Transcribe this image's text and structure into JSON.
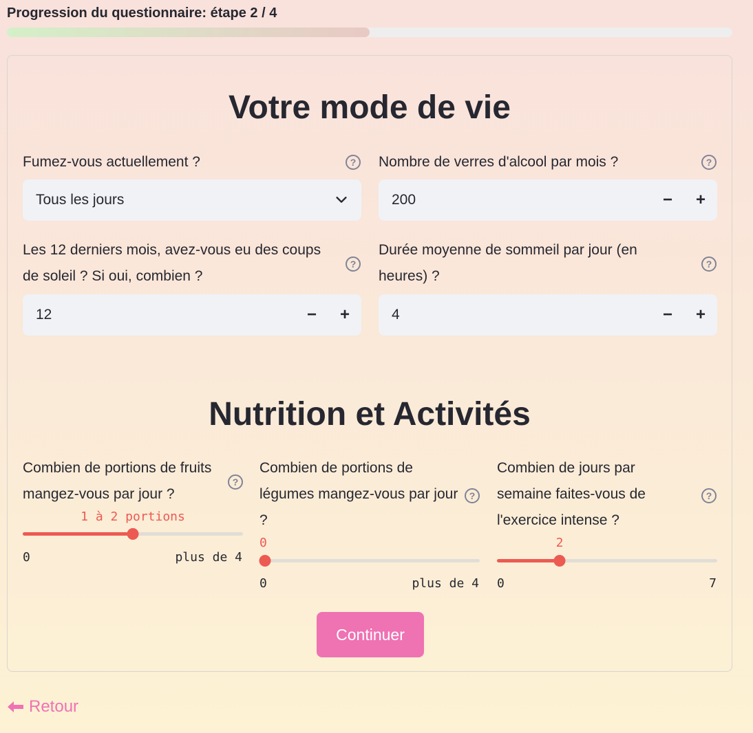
{
  "progress": {
    "label": "Progression du questionnaire: étape 2 / 4",
    "fraction": 0.5
  },
  "lifestyle": {
    "title": "Votre mode de vie",
    "smoking": {
      "label": "Fumez-vous actuellement ?",
      "value": "Tous les jours"
    },
    "alcohol": {
      "label": "Nombre de verres d'alcool par mois ?",
      "value": "200"
    },
    "sunburn": {
      "label": "Les 12 derniers mois, avez-vous eu des coups de soleil ? Si oui, combien ?",
      "value": "12"
    },
    "sleep": {
      "label": "Durée moyenne de sommeil par jour (en heures) ?",
      "value": "4"
    }
  },
  "nutrition": {
    "title": "Nutrition et Activités",
    "fruits": {
      "label": "Combien de portions de fruits mangez-vous par jour ?",
      "value_label": "1 à 2 portions",
      "min": "0",
      "max": "plus de 4",
      "fraction": 0.5
    },
    "vegetables": {
      "label": "Combien de portions de légumes mangez-vous par jour ?",
      "value_label": "0",
      "min": "0",
      "max": "plus de 4",
      "fraction": 0.0
    },
    "exercise": {
      "label": "Combien de jours par semaine faites-vous de l'exercice intense ?",
      "value_label": "2",
      "min": "0",
      "max": "7",
      "fraction": 0.2857
    }
  },
  "buttons": {
    "continue": "Continuer",
    "back": "Retour",
    "minus": "−",
    "plus": "+",
    "help": "?"
  },
  "colors": {
    "accent": "#ec5a52",
    "primary_button": "#ef72b3",
    "input_bg": "#f0f2f6"
  }
}
